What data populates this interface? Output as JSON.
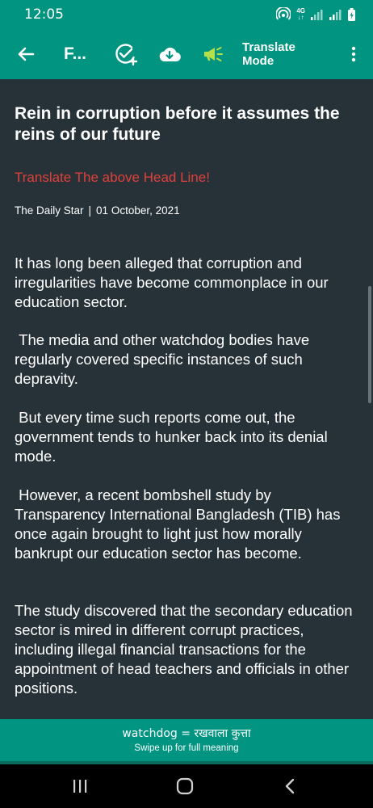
{
  "status": {
    "time": "12:05",
    "network_top": "4G",
    "network_bottom": "↓↑"
  },
  "toolbar": {
    "title": "F...",
    "mode_label": "Translate Mode"
  },
  "article": {
    "headline": "Rein in corruption before it assumes the reins of our future",
    "translate_prompt": "Translate The above Head Line!",
    "source": "The Daily Star",
    "separator": "|",
    "date": "01 October, 2021",
    "paragraphs": [
      "It has long been alleged that corruption and irregularities have become commonplace in our education sector.",
      " The media and other watchdog bodies have regularly covered specific instances of such depravity.",
      " But every time such reports come out, the government tends to hunker back into its denial mode.",
      " However, a recent bombshell study by Transparency International Bangladesh (TIB) has once again brought to light just how morally bankrupt our education sector has become.",
      "The study discovered that the secondary education sector is mired in different corrupt practices, including illegal financial transactions for the appointment of head teachers and officials in other positions."
    ]
  },
  "meaning": {
    "word_line": "watchdog = रखवाला  कुत्ता",
    "hint": "Swipe up for full meaning"
  },
  "colors": {
    "primary": "#009481",
    "background": "#263238",
    "accent_green": "#b4e04a",
    "link_red": "#e0403a"
  }
}
